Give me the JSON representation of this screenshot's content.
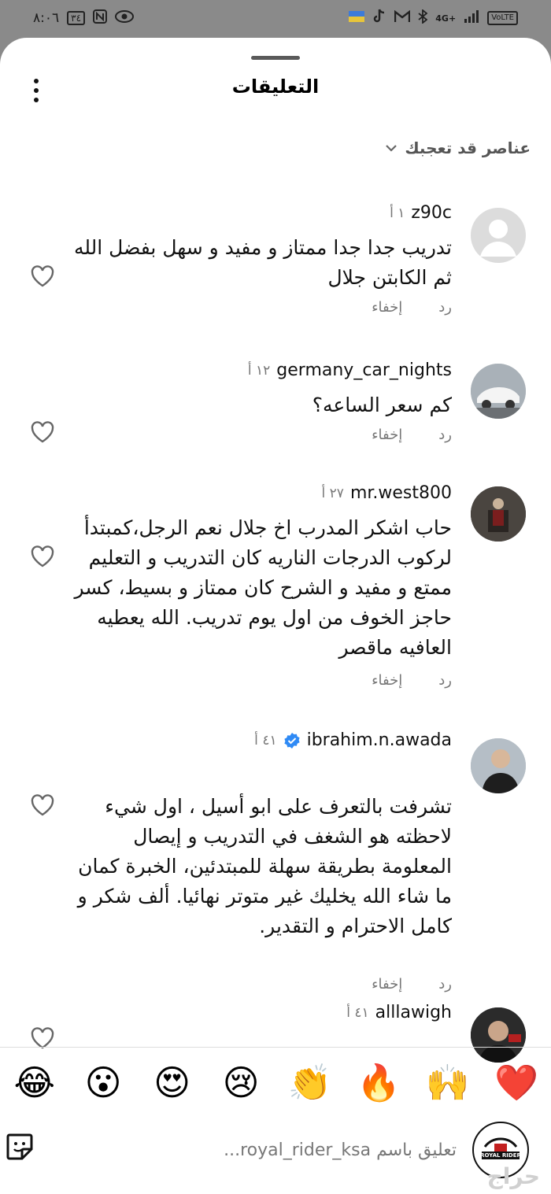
{
  "status_bar": {
    "time": "٨:٠٦",
    "battery": "٣٤",
    "network": "4G+",
    "volte": "VoLTE"
  },
  "sheet": {
    "title": "التعليقات",
    "filter_label": "عناصر قد تعجبك"
  },
  "comments": [
    {
      "username": "z90c",
      "time": "١ أ",
      "text": "تدريب جدا جدا ممتاز و مفيد و سهل بفضل الله ثم الكابتن جلال",
      "reply_label": "رد",
      "hide_label": "إخفاء",
      "verified": false
    },
    {
      "username": "germany_car_nights",
      "time": "١٢ أ",
      "text": "كم سعر الساعه؟",
      "reply_label": "رد",
      "hide_label": "إخفاء",
      "verified": false
    },
    {
      "username": "mr.west800",
      "time": "٢٧ أ",
      "text": "حاب اشكر المدرب اخ جلال نعم الرجل،كمبتدأ لركوب الدرجات الناريه كان التدريب و التعليم ممتع و مفيد و الشرح كان ممتاز و بسيط، كسر حاجز الخوف من اول يوم تدريب. الله يعطيه العافيه ماقصر",
      "reply_label": "رد",
      "hide_label": "إخفاء",
      "verified": false
    },
    {
      "username": "ibrahim.n.awada",
      "time": "٤١ أ",
      "text": "تشرفت بالتعرف على ابو أسيل ، اول شيء لاحظته هو الشغف في التدريب و إيصال المعلومة بطريقة سهلة للمبتدئين، الخبرة كمان ما شاء الله يخليك غير متوتر نهائيا. ألف شكر و كامل الاحترام و التقدير.",
      "reply_label": "رد",
      "hide_label": "إخفاء",
      "verified": true
    },
    {
      "username": "alllawigh",
      "time": "٤١ أ",
      "text": "",
      "verified": false
    }
  ],
  "emoji_reactions": [
    "❤️",
    "🙌",
    "🔥",
    "👏",
    "😢",
    "😍",
    "😮",
    "😂"
  ],
  "input": {
    "placeholder": "تعليق باسم royal_rider_ksa...",
    "avatar_text": "ROYAL RIDER"
  },
  "watermark": "حراج"
}
